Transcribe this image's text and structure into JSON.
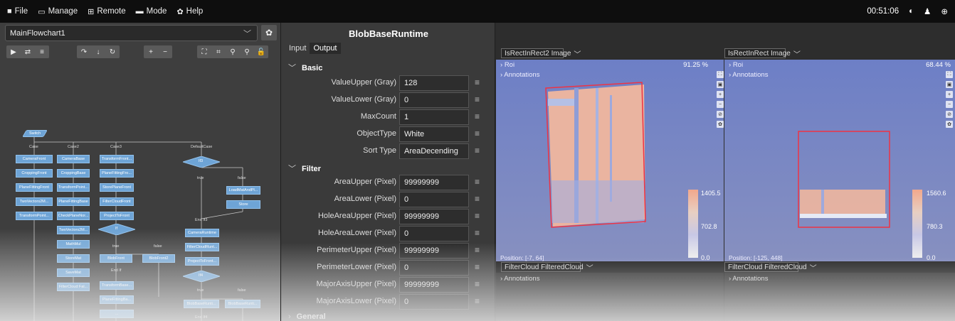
{
  "menu": {
    "file": "File",
    "manage": "Manage",
    "remote": "Remote",
    "mode": "Mode",
    "help": "Help"
  },
  "clock": "00:51:06",
  "flow": {
    "selected": "MainFlowchart1"
  },
  "flowchart": {
    "switch": "Switch",
    "cases": [
      "Case",
      "Case2",
      "Case3",
      "DefaultCase"
    ],
    "col1": [
      "CameraFront",
      "CroppingFront",
      "PlaneFittingFront",
      "TwoVectors2M...",
      "TransformPoint..."
    ],
    "col2": [
      "CameraBase",
      "CroppingBase",
      "TransformPoint...",
      "PlaneFittingBase",
      "CheckPlaneNor...",
      "TwoVectors2M...",
      "MathMul",
      "StoreMat",
      "SaveMat",
      "FilterCloud Fal..."
    ],
    "col3": [
      "TransformFront...",
      "PlaneFittingFro...",
      "StorePlaneFront",
      "FilterCloudFront",
      "ProjectToFront"
    ],
    "if1": "If",
    "if1_true": "true",
    "if1_false": "false",
    "blob_front": "BlobFront",
    "blob_front2": "BlobFront2",
    "endif1": "End If",
    "col3b": [
      "TransformBase...",
      "PlaneFittingBa...",
      "..."
    ],
    "if3": "If3",
    "if3_true": "true",
    "if3_false": "false",
    "load_mat": "LoadMatAndPl...",
    "store": "Store",
    "endif3": "End If3",
    "camera_runtime": "CameraRuntime",
    "filtercloud_runt": "FilterCloudRunt...",
    "project_to_front": "ProjectToFront...",
    "if4": "If4",
    "if4_true": "true",
    "if4_false": "false",
    "blob_runtime": "BlobBaseRunti...",
    "blob_runtime2": "BlobBaseRunti...",
    "endif4": "End If4"
  },
  "panel": {
    "title": "BlobBaseRuntime",
    "tabs": [
      "Input",
      "Output"
    ],
    "basic": "Basic",
    "filter": "Filter",
    "general": "General",
    "basic_rows": [
      {
        "name": "ValueUpper (Gray)",
        "value": "128"
      },
      {
        "name": "ValueLower (Gray)",
        "value": "0"
      },
      {
        "name": "MaxCount",
        "value": "1"
      },
      {
        "name": "ObjectType",
        "value": "White"
      },
      {
        "name": "Sort Type",
        "value": "AreaDecending"
      }
    ],
    "filter_rows": [
      {
        "name": "AreaUpper (Pixel)",
        "value": "99999999"
      },
      {
        "name": "AreaLower (Pixel)",
        "value": "0"
      },
      {
        "name": "HoleAreaUpper (Pixel)",
        "value": "99999999"
      },
      {
        "name": "HoleAreaLower (Pixel)",
        "value": "0"
      },
      {
        "name": "PerimeterUpper (Pixel)",
        "value": "99999999"
      },
      {
        "name": "PerimeterLower (Pixel)",
        "value": "0"
      },
      {
        "name": "MajorAxisUpper (Pixel)",
        "value": "99999999"
      },
      {
        "name": "MajorAxisLower (Pixel)",
        "value": "0"
      }
    ]
  },
  "view1": {
    "select": "IsRectInRect2 Image",
    "roi": "Roi",
    "annotations": "Annotations",
    "pct": "91.25 %",
    "cmax": "1405.5",
    "cmid": "702.8",
    "cmin": "0.0",
    "position": "Position: [-7, 64]",
    "lower_select": "FilterCloud FilteredCloud",
    "lower_annotations": "Annotations"
  },
  "view2": {
    "select": "IsRectInRect Image",
    "roi": "Roi",
    "annotations": "Annotations",
    "pct": "68.44 %",
    "cmax": "1560.6",
    "cmid": "780.3",
    "cmin": "0.0",
    "position": "Position: [-125, 448]",
    "lower_select": "FilterCloud FilteredCloud",
    "lower_annotations": "Annotations"
  }
}
